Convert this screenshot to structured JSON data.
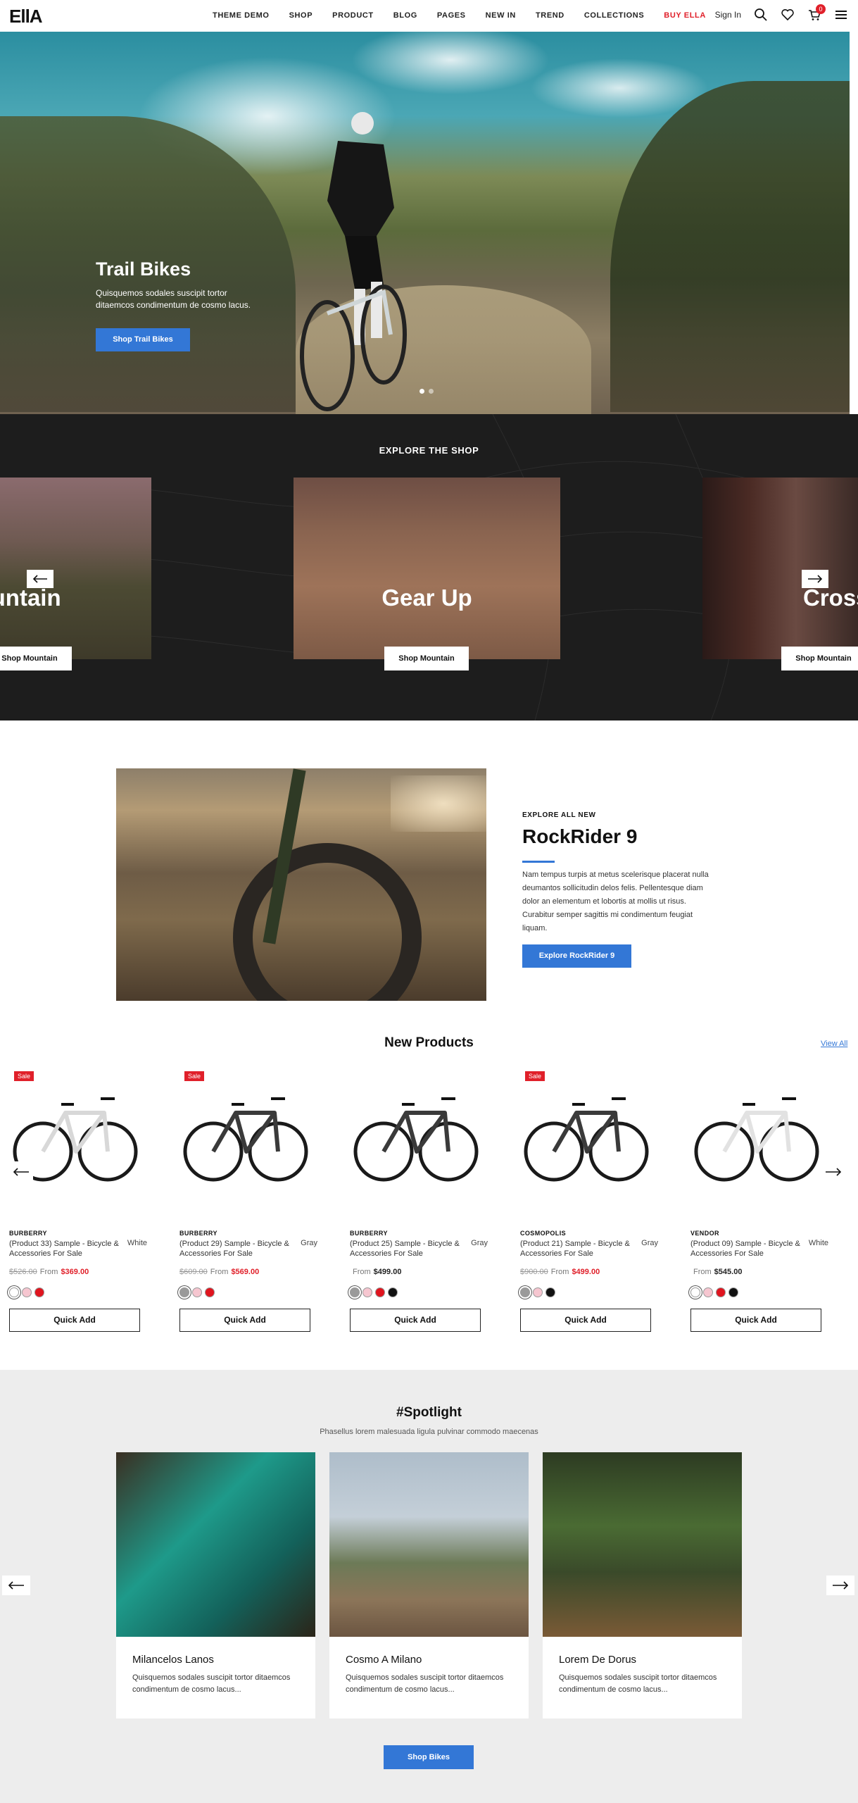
{
  "header": {
    "logo": "EllA",
    "nav": [
      "THEME DEMO",
      "SHOP",
      "PRODUCT",
      "BLOG",
      "PAGES",
      "NEW IN",
      "TREND",
      "COLLECTIONS",
      "BUY ELLA"
    ],
    "sign_in": "Sign In",
    "cart_count": "0"
  },
  "hero": {
    "title": "Trail Bikes",
    "subtitle": "Quisquemos sodales suscipit tortor ditaemcos condimentum de cosmo lacus.",
    "button": "Shop Trail Bikes",
    "slides": 2,
    "active_slide": 1
  },
  "explore": {
    "title": "EXPLORE THE SHOP",
    "cards": [
      {
        "label": "Mountain",
        "button": "Shop Mountain"
      },
      {
        "label": "Gear Up",
        "button": "Shop Mountain"
      },
      {
        "label": "Cross",
        "button": "Shop Mountain"
      }
    ]
  },
  "feature": {
    "kicker": "EXPLORE ALL NEW",
    "title": "RockRider 9",
    "text": "Nam tempus turpis at metus scelerisque placerat nulla deumantos sollicitudin delos felis. Pellentesque diam dolor an elementum et lobortis at mollis ut risus. Curabitur semper sagittis mi condimentum feugiat liquam.",
    "button": "Explore RockRider 9"
  },
  "products": {
    "title": "New Products",
    "view_all": "View All",
    "quick_add": "Quick Add",
    "items": [
      {
        "sale": "Sale",
        "vendor": "BURBERRY",
        "name": "(Product 33) Sample - Bicycle & Accessories For Sale",
        "color": "White",
        "old_price": "$526.00",
        "from": "From",
        "price": "$369.00",
        "on_sale": true,
        "swatches": [
          "#ffffff",
          "#f6c6d0",
          "#e0141e"
        ],
        "frame": "#d8d8d8"
      },
      {
        "sale": "Sale",
        "vendor": "BURBERRY",
        "name": "(Product 29) Sample - Bicycle & Accessories For Sale",
        "color": "Gray",
        "old_price": "$609.00",
        "from": "From",
        "price": "$569.00",
        "on_sale": true,
        "swatches": [
          "#9a9a9a",
          "#f6c6d0",
          "#e0141e"
        ],
        "frame": "#3a3a3a"
      },
      {
        "sale": "",
        "vendor": "BURBERRY",
        "name": "(Product 25) Sample - Bicycle & Accessories For Sale",
        "color": "Gray",
        "old_price": "",
        "from": "From",
        "price": "$499.00",
        "on_sale": false,
        "swatches": [
          "#9a9a9a",
          "#f6c6d0",
          "#e0141e",
          "#111111"
        ],
        "frame": "#3a3a3a"
      },
      {
        "sale": "Sale",
        "vendor": "COSMOPOLIS",
        "name": "(Product 21) Sample - Bicycle & Accessories For Sale",
        "color": "Gray",
        "old_price": "$900.00",
        "from": "From",
        "price": "$499.00",
        "on_sale": true,
        "swatches": [
          "#9a9a9a",
          "#f6c6d0",
          "#111111"
        ],
        "frame": "#3a3a3a"
      },
      {
        "sale": "",
        "vendor": "VENDOR",
        "name": "(Product 09) Sample - Bicycle & Accessories For Sale",
        "color": "White",
        "old_price": "",
        "from": "From",
        "price": "$545.00",
        "on_sale": false,
        "swatches": [
          "#ffffff",
          "#f6c6d0",
          "#e0141e",
          "#111111"
        ],
        "frame": "#e2e2e2"
      }
    ]
  },
  "spotlight": {
    "title": "#Spotlight",
    "subtitle": "Phasellus lorem malesuada ligula pulvinar commodo maecenas",
    "cards": [
      {
        "name": "Milancelos Lanos",
        "desc": "Quisquemos sodales suscipit tortor ditaemcos condimentum de cosmo lacus..."
      },
      {
        "name": "Cosmo A Milano",
        "desc": "Quisquemos sodales suscipit tortor ditaemcos condimentum de cosmo lacus..."
      },
      {
        "name": "Lorem De Dorus",
        "desc": "Quisquemos sodales suscipit tortor ditaemcos condimentum de cosmo lacus..."
      }
    ],
    "button": "Shop Bikes"
  },
  "colors": {
    "accent": "#3377d6",
    "sale": "#e0202a",
    "dark": "#1d1d1d",
    "spot_bg": "#ededed"
  }
}
